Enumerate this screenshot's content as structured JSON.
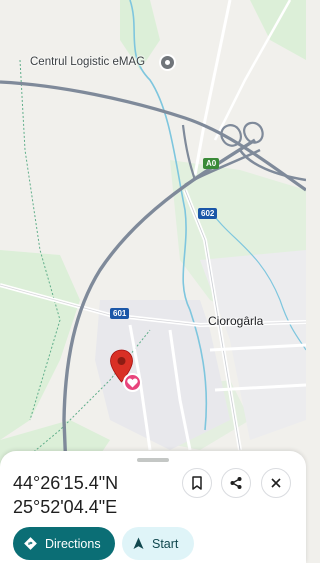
{
  "map": {
    "poi_label": "Centrul Logistic eMAG",
    "place_label": "Ciorogârla",
    "road_shields": {
      "a0": "A0",
      "r602": "602",
      "r601": "601"
    },
    "colors": {
      "land": "#f1f0ec",
      "green": "#dcefd8",
      "water": "#7ec6de",
      "highway": "#7f8a9a",
      "road": "#ffffff",
      "pin_red": "#d93025",
      "pin_favorite": "#e8447c"
    },
    "icons": [
      "poi-pin-icon",
      "location-pin-icon",
      "heart-icon"
    ]
  },
  "sheet": {
    "latitude": "44°26'15.4\"N",
    "longitude": "25°52'04.4\"E",
    "directions_label": "Directions",
    "start_label": "Start",
    "icons": [
      "bookmark-icon",
      "share-icon",
      "close-icon",
      "directions-icon",
      "navigation-arrow-icon"
    ]
  }
}
